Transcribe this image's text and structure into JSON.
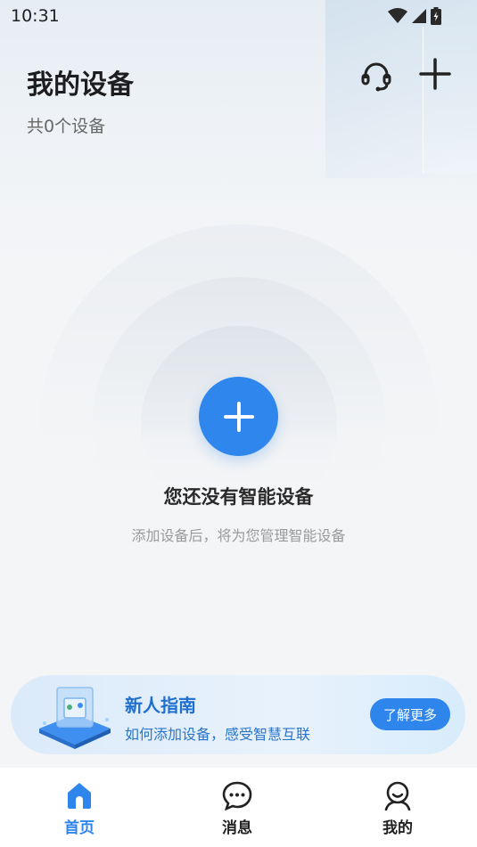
{
  "status_bar": {
    "time": "10:31"
  },
  "header": {
    "title": "我的设备",
    "device_count": "共0个设备",
    "support_icon": "headset-icon",
    "add_icon": "plus-icon"
  },
  "empty_state": {
    "add_icon": "plus-icon",
    "title": "您还没有智能设备",
    "description": "添加设备后，将为您管理智能设备"
  },
  "guide_banner": {
    "title": "新人指南",
    "description": "如何添加设备，感受智慧互联",
    "button_label": "了解更多"
  },
  "tab_bar": {
    "items": [
      {
        "label": "首页",
        "icon": "home-icon",
        "active": true
      },
      {
        "label": "消息",
        "icon": "chat-icon",
        "active": false
      },
      {
        "label": "我的",
        "icon": "profile-icon",
        "active": false
      }
    ]
  },
  "colors": {
    "accent": "#2e86ec",
    "background": "#f4f5f7",
    "banner_text": "#1e6fd0"
  }
}
